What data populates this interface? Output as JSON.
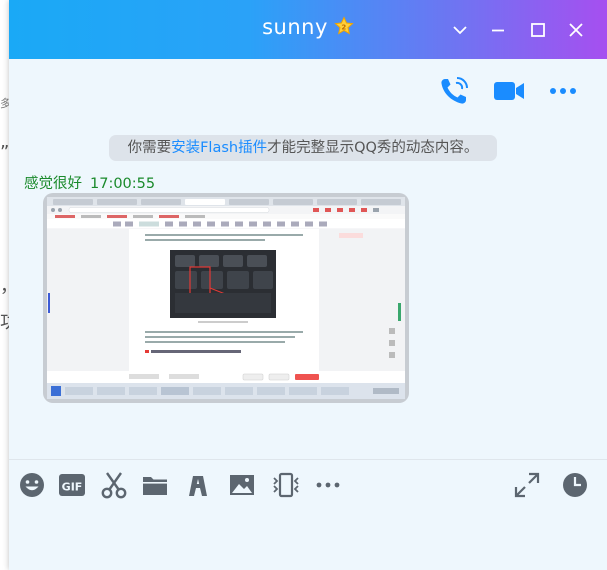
{
  "window": {
    "title": "sunny",
    "title_badge_icon": "star-badge-icon",
    "controls": [
      "chevron-down-icon",
      "minimize-icon",
      "maximize-icon",
      "close-icon"
    ]
  },
  "header_actions": [
    "voice-call-icon",
    "video-call-icon",
    "more-icon"
  ],
  "notice": {
    "prefix": "你需要",
    "link": "安装Flash插件",
    "suffix": "才能完整显示QQ秀的动态内容。"
  },
  "message": {
    "sender": "感觉很好",
    "time": "17:00:55",
    "attachment": "screenshot-image"
  },
  "background_fragments": [
    "多",
    "”",
    "，",
    "功"
  ],
  "input_toolbar": [
    "emoji-icon",
    "gif-icon",
    "scissors-icon",
    "folder-icon",
    "ai-icon",
    "image-icon",
    "screen-record-icon",
    "more-icon"
  ],
  "input_toolbar_right": [
    "expand-icon",
    "history-clock-icon"
  ],
  "colors": {
    "title_gradient_start": "#1aa9f6",
    "title_gradient_end": "#a64ff0",
    "icon_blue": "#1a8cff",
    "sender_green": "#1a8a2b",
    "link_blue": "#1a8cff",
    "icon_gray": "#5c6670"
  }
}
